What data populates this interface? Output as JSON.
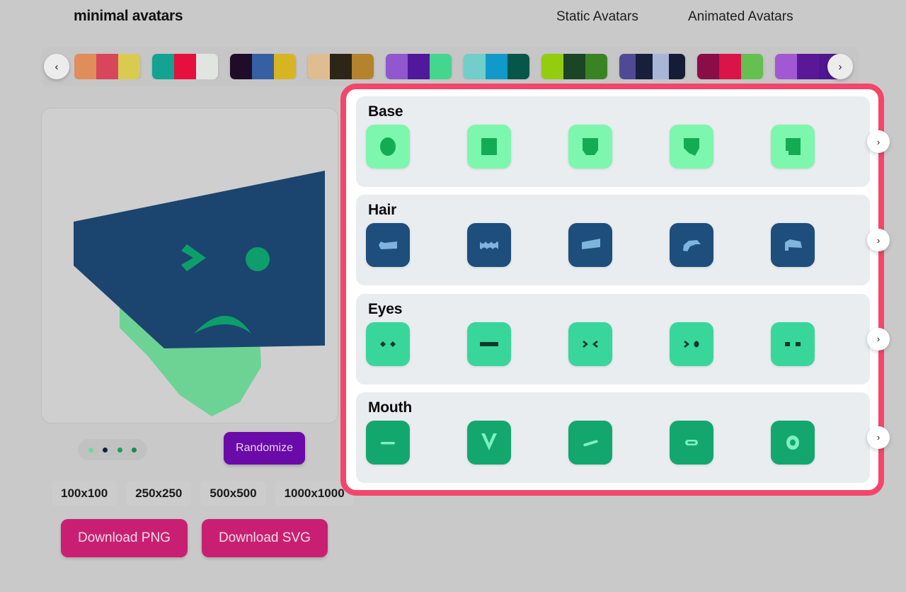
{
  "header": {
    "brand": "minimal avatars",
    "nav": [
      {
        "label": "Static Avatars",
        "name": "nav-static"
      },
      {
        "label": "Animated Avatars",
        "name": "nav-animated"
      }
    ]
  },
  "palette_strip": {
    "prev_icon": "chevron-left-icon",
    "next_icon": "chevron-right-icon",
    "prev_glyph": "‹",
    "next_glyph": "›",
    "palettes": [
      {
        "colors": [
          "#df8d5b",
          "#d8465c",
          "#d9cb4f"
        ]
      },
      {
        "colors": [
          "#12a391",
          "#e60f3e",
          "#e2e4e1"
        ]
      },
      {
        "colors": [
          "#200c28",
          "#3560a3",
          "#d6b521"
        ]
      },
      {
        "colors": [
          "#e0bd90",
          "#2d2518",
          "#b5822d"
        ]
      },
      {
        "colors": [
          "#9057cf",
          "#51189c",
          "#44d68e"
        ]
      },
      {
        "colors": [
          "#71cec8",
          "#0f9ac9",
          "#06564a"
        ]
      },
      {
        "colors": [
          "#94cc10",
          "#1b4524",
          "#3a8323"
        ]
      },
      {
        "colors": [
          "#504a94",
          "#181f3d",
          "#a9b5d6",
          "#151d36"
        ]
      },
      {
        "colors": [
          "#8b0d46",
          "#da1349",
          "#66c04f"
        ]
      },
      {
        "colors": [
          "#a258d3",
          "#5b1896",
          "#4e1690"
        ]
      }
    ]
  },
  "preview": {
    "avatar": {
      "skin_color": "#6dd395",
      "skin_shadow": "#0d9e6b",
      "hair_color": "#1b456e",
      "background": "#cfcfcf"
    },
    "dots": [
      {
        "color": "#69d9a2"
      },
      {
        "color": "#13213d"
      },
      {
        "color": "#16a05f"
      },
      {
        "color": "#1a8a52"
      }
    ],
    "randomize_label": "Randomize",
    "randomize_color": "#6a0aa8",
    "sizes": [
      "100x100",
      "250x250",
      "500x500",
      "1000x1000"
    ],
    "downloads": [
      {
        "label": "Download PNG",
        "name": "download-png-button"
      },
      {
        "label": "Download SVG",
        "name": "download-svg-button"
      }
    ],
    "download_color": "#c91f72"
  },
  "options_panel": {
    "border_color": "#f4466a",
    "next_glyph": "›",
    "sections": [
      {
        "title": "Base",
        "name": "base",
        "tile_bg": "#7cf7ad",
        "shape_color": "#13ac54",
        "items": [
          {
            "name": "base-shape-ellipse",
            "shape": "ellipse"
          },
          {
            "name": "base-shape-square",
            "shape": "square"
          },
          {
            "name": "base-shape-shield",
            "shape": "shield"
          },
          {
            "name": "base-shape-pentagon",
            "shape": "pentagon"
          },
          {
            "name": "base-shape-notched",
            "shape": "notched"
          }
        ]
      },
      {
        "title": "Hair",
        "name": "hair",
        "tile_bg": "#1d4e7c",
        "shape_color": "#7fb4de",
        "items": [
          {
            "name": "hair-style-swoop-left",
            "shape": "swoop-left"
          },
          {
            "name": "hair-style-wavy",
            "shape": "wavy"
          },
          {
            "name": "hair-style-wedge",
            "shape": "wedge"
          },
          {
            "name": "hair-style-curl-right",
            "shape": "curl-right"
          },
          {
            "name": "hair-style-flat-sweep",
            "shape": "flat-sweep"
          }
        ]
      },
      {
        "title": "Eyes",
        "name": "eyes",
        "tile_bg": "#39d69b",
        "shape_color": "#0d3a2c",
        "items": [
          {
            "name": "eyes-style-diamonds",
            "shape": "diamonds"
          },
          {
            "name": "eyes-style-bar",
            "shape": "bar"
          },
          {
            "name": "eyes-style-angle-in",
            "shape": "angle-in"
          },
          {
            "name": "eyes-style-angle-dot",
            "shape": "angle-dot"
          },
          {
            "name": "eyes-style-squares",
            "shape": "squares"
          }
        ]
      },
      {
        "title": "Mouth",
        "name": "mouth",
        "tile_bg": "#13a76d",
        "shape_color": "#7df0c2",
        "items": [
          {
            "name": "mouth-style-line",
            "shape": "line"
          },
          {
            "name": "mouth-style-vee",
            "shape": "vee"
          },
          {
            "name": "mouth-style-slant",
            "shape": "slant"
          },
          {
            "name": "mouth-style-pill",
            "shape": "pill"
          },
          {
            "name": "mouth-style-oval",
            "shape": "oval"
          }
        ]
      }
    ]
  }
}
